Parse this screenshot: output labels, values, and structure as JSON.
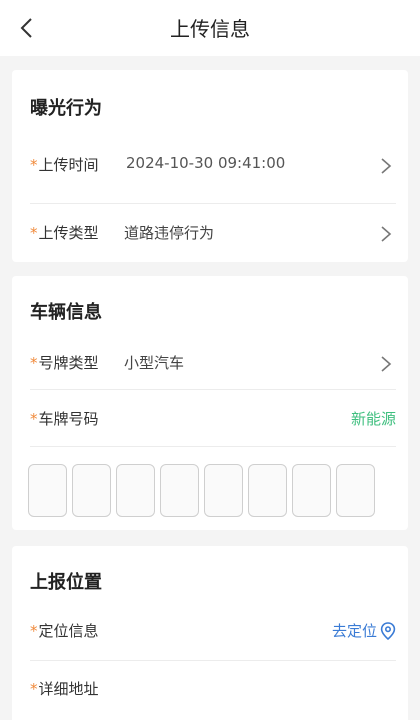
{
  "header": {
    "title": "上传信息"
  },
  "exposure": {
    "title": "曝光行为",
    "required_mark": "*",
    "upload_time_label": "上传时间",
    "upload_time_value": "2024-10-30 09:41:00",
    "upload_type_label": "上传类型",
    "upload_type_value": "道路违停行为"
  },
  "vehicle": {
    "title": "车辆信息",
    "plate_type_label": "号牌类型",
    "plate_type_value": "小型汽车",
    "plate_number_label": "车牌号码",
    "new_energy_label": "新能源",
    "plate_slot_count": 8
  },
  "location": {
    "title": "上报位置",
    "location_info_label": "定位信息",
    "go_locate_label": "去定位",
    "address_label": "详细地址"
  },
  "colors": {
    "required": "#f08a3c",
    "green_link": "#3fbf7f",
    "blue_link": "#3a7bd5"
  }
}
